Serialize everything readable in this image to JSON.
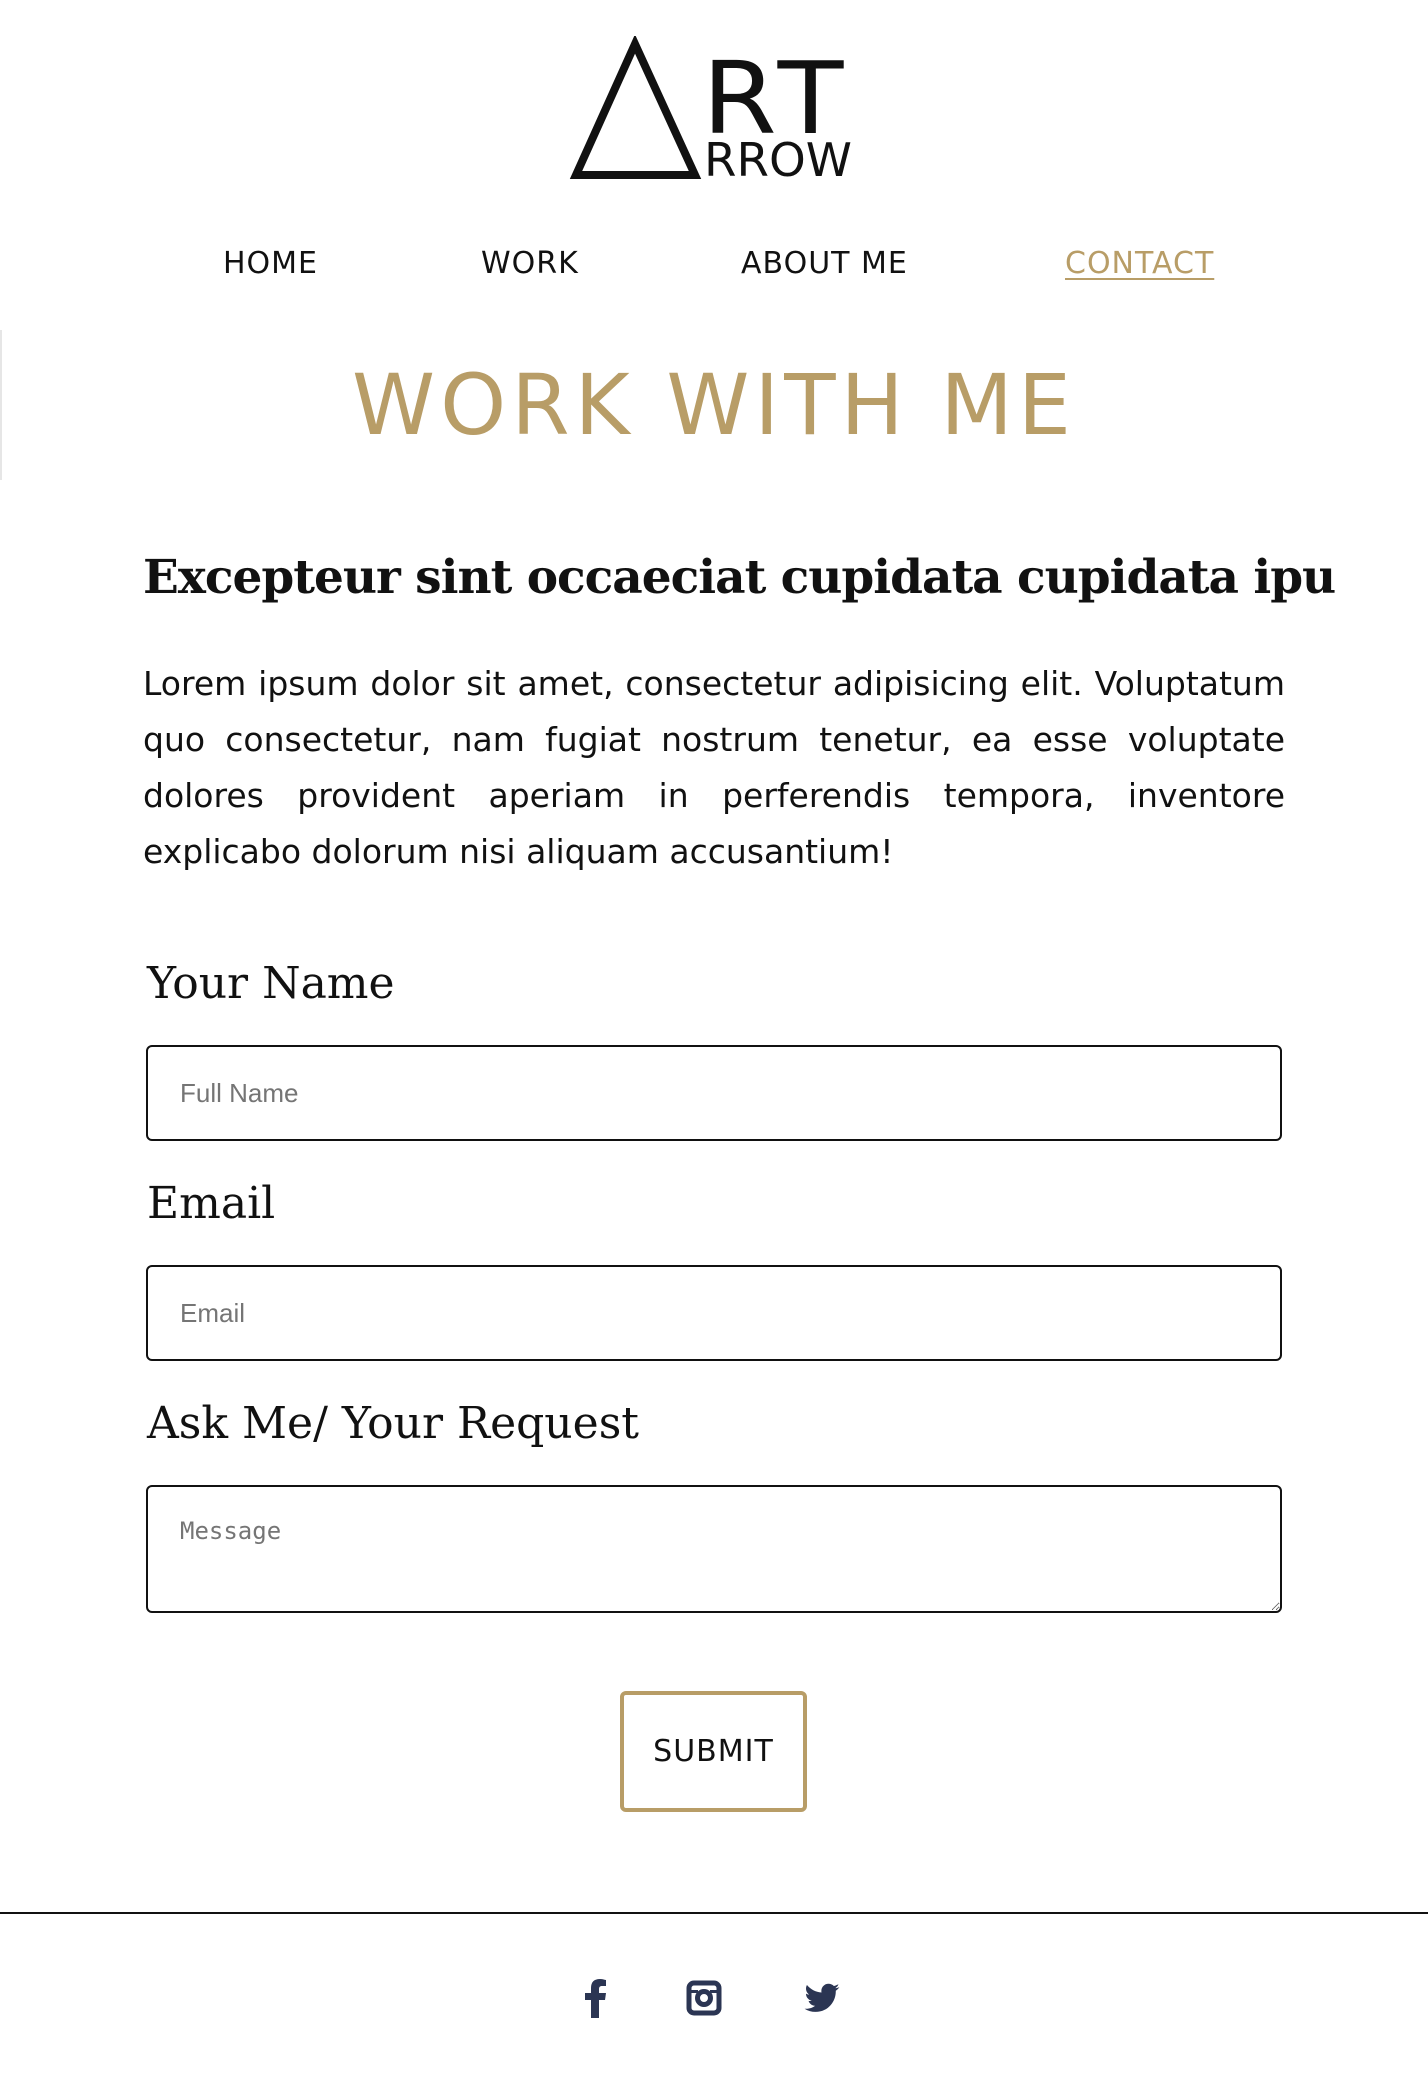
{
  "brand": {
    "logo_top": "RT",
    "logo_bottom": "RROW"
  },
  "nav": {
    "items": [
      {
        "label": "HOME"
      },
      {
        "label": "WORK"
      },
      {
        "label": "ABOUT ME"
      },
      {
        "label": "CONTACT",
        "active": true
      }
    ]
  },
  "page": {
    "title": "WORK WITH ME",
    "subheading": "Excepteur sint occaeciat cupidata cupidata ipu",
    "intro": "Lorem ipsum dolor sit amet, consectetur adipisicing elit. Voluptatum quo consectetur, nam fugiat nostrum tenetur, ea esse voluptate dolores provident aperiam in perferendis tempora, inventore explicabo dolorum nisi aliquam accusantium!"
  },
  "form": {
    "name_label": "Your Name",
    "name_placeholder": "Full Name",
    "name_value": "",
    "email_label": "Email",
    "email_placeholder": "Email",
    "email_value": "",
    "message_label": "Ask Me/ Your Request",
    "message_placeholder": "Message",
    "message_value": "",
    "submit_label": "SUBMIT"
  },
  "footer": {
    "social": [
      "facebook-icon",
      "instagram-icon",
      "twitter-icon"
    ]
  },
  "colors": {
    "accent": "#b89d67",
    "text": "#111111",
    "social_icon": "#2b3553",
    "placeholder": "#757575"
  }
}
